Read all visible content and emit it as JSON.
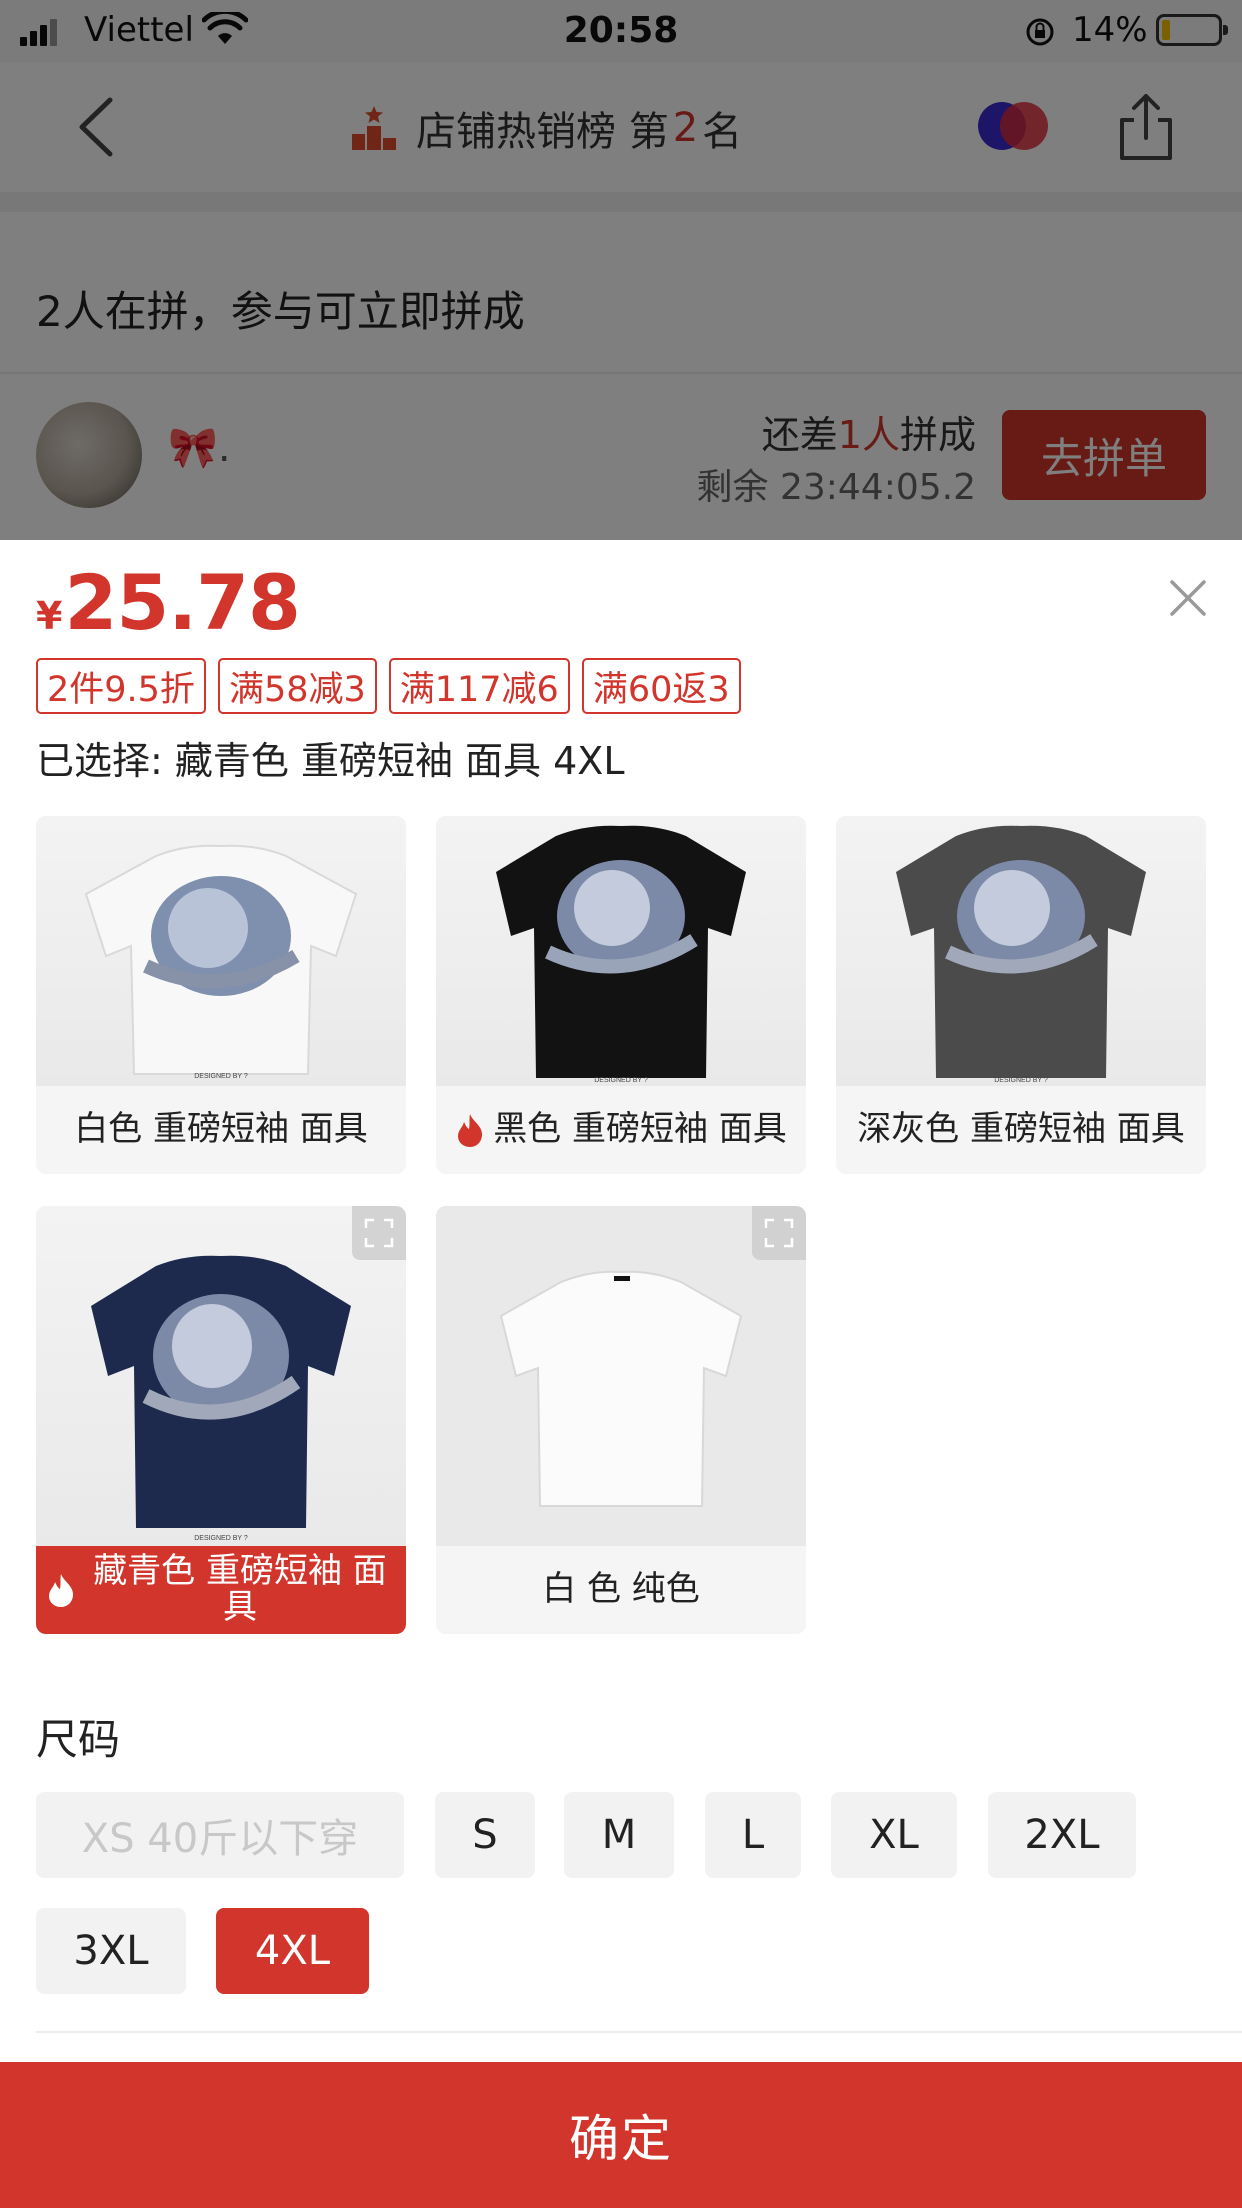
{
  "status_bar": {
    "carrier": "Viettel",
    "time": "20:58",
    "battery_percent": "14%",
    "icons": [
      "signal-icon",
      "wifi-icon",
      "rotation-lock-icon",
      "battery-icon"
    ]
  },
  "navbar": {
    "title_prefix": "店铺热销榜 第",
    "rank": "2",
    "title_suffix": "名",
    "icons": [
      "back-icon",
      "rank-icon",
      "avatar-icon",
      "share-icon"
    ]
  },
  "group": {
    "headline": "2人在拼，参与可立即拼成",
    "user_name": "🎀",
    "user_name_suffix": ".",
    "need_prefix": "还差",
    "need_count": "1人",
    "need_suffix": "拼成",
    "remaining": "剩余 23:44:05.2",
    "join_label": "去拼单"
  },
  "sheet": {
    "currency": "¥",
    "price": "25.78",
    "coupons": [
      "2件9.5折",
      "满58减3",
      "满117减6",
      "满60返3"
    ],
    "selected_text": "已选择: 藏青色 重磅短袖 面具 4XL",
    "skus": [
      {
        "label": "白色 重磅短袖 面具",
        "hot": false,
        "selected": false
      },
      {
        "label": "黑色 重磅短袖 面具",
        "hot": true,
        "selected": false
      },
      {
        "label": "深灰色 重磅短袖 面具",
        "hot": false,
        "selected": false
      },
      {
        "label": "藏青色 重磅短袖 面具",
        "hot": true,
        "selected": true
      },
      {
        "label": "白 色 纯色",
        "hot": false,
        "selected": false
      }
    ],
    "size_title": "尺码",
    "sizes": [
      {
        "label": "XS 40斤以下穿",
        "state": "disabled"
      },
      {
        "label": "S",
        "state": "normal"
      },
      {
        "label": "M",
        "state": "normal"
      },
      {
        "label": "L",
        "state": "normal"
      },
      {
        "label": "XL",
        "state": "normal"
      },
      {
        "label": "2XL",
        "state": "normal"
      },
      {
        "label": "3XL",
        "state": "normal"
      },
      {
        "label": "4XL",
        "state": "selected"
      }
    ],
    "confirm_label": "确定"
  },
  "colors": {
    "accent": "#d1352b",
    "overlay": "rgba(0,0,0,0.5)"
  }
}
